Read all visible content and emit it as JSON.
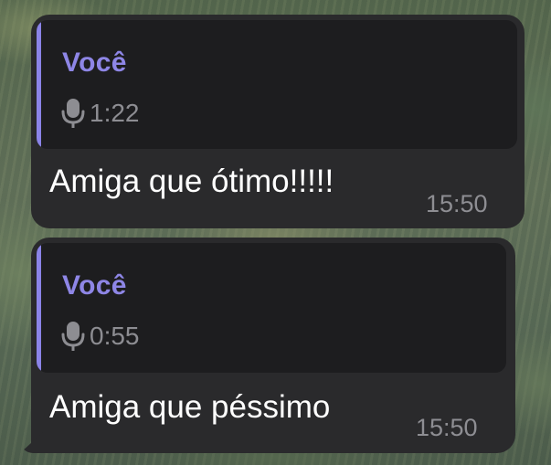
{
  "messages": [
    {
      "reply": {
        "author": "Você",
        "type": "voice-message",
        "duration": "1:22"
      },
      "text": "Amiga que ótimo!!!!!",
      "time": "15:50"
    },
    {
      "reply": {
        "author": "Você",
        "type": "voice-message",
        "duration": "0:55"
      },
      "text": "Amiga que péssimo",
      "time": "15:50"
    }
  ],
  "colors": {
    "bubble": "#2a2a2c",
    "quote_background": "#1d1d1f",
    "accent": "#8b84e8",
    "text": "#ffffff",
    "secondary_text": "#8e8e93"
  },
  "icons": {
    "voice": "microphone-icon"
  }
}
